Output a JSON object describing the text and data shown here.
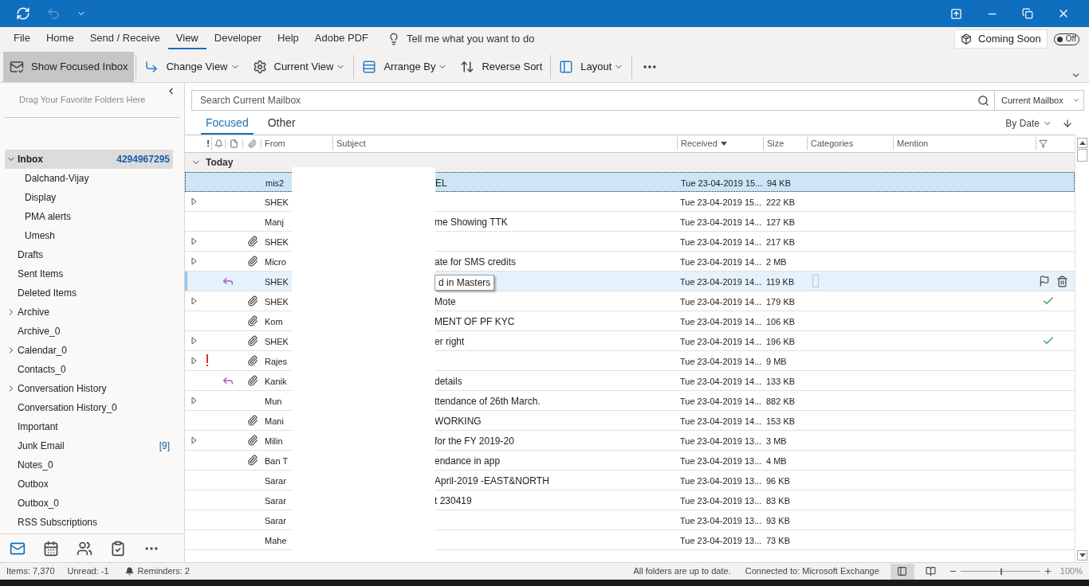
{
  "menu_tabs": [
    {
      "label": "File",
      "selected": false
    },
    {
      "label": "Home",
      "selected": false
    },
    {
      "label": "Send / Receive",
      "selected": false
    },
    {
      "label": "View",
      "selected": true
    },
    {
      "label": "Developer",
      "selected": false
    },
    {
      "label": "Help",
      "selected": false
    },
    {
      "label": "Adobe PDF",
      "selected": false
    }
  ],
  "tell_me": {
    "placeholder": "Tell me what you want to do"
  },
  "coming_soon": {
    "label": "Coming Soon",
    "toggle_label": "Off",
    "on": false
  },
  "ribbon": [
    {
      "kind": "focused",
      "label": "Show Focused Inbox",
      "selected": true
    },
    {
      "kind": "change",
      "label": "Change View",
      "selected": false
    },
    {
      "kind": "current",
      "label": "Current View",
      "selected": false
    },
    {
      "kind": "arrange",
      "label": "Arrange By",
      "selected": false
    },
    {
      "kind": "reverse",
      "label": "Reverse Sort",
      "selected": false
    },
    {
      "kind": "layout",
      "label": "Layout",
      "selected": false
    }
  ],
  "favorites_hint": "Drag Your Favorite Folders Here",
  "folders": [
    {
      "name": "Inbox",
      "count": "4294967295",
      "selected": true,
      "expanded": true,
      "children": [
        {
          "name": "Dalchand-Vijay",
          "selected": false
        },
        {
          "name": "Display",
          "selected": false
        },
        {
          "name": "PMA alerts",
          "selected": false
        },
        {
          "name": "Umesh",
          "selected": false
        }
      ]
    },
    {
      "name": "Drafts",
      "selected": false
    },
    {
      "name": "Sent Items",
      "selected": false
    },
    {
      "name": "Deleted Items",
      "selected": false
    },
    {
      "name": "Archive",
      "selected": false,
      "expanded": false
    },
    {
      "name": "Archive_0",
      "selected": false
    },
    {
      "name": "Calendar_0",
      "selected": false,
      "expanded": false
    },
    {
      "name": "Contacts_0",
      "selected": false
    },
    {
      "name": "Conversation History",
      "selected": false,
      "expanded": false
    },
    {
      "name": "Conversation History_0",
      "selected": false
    },
    {
      "name": "Important",
      "selected": false
    },
    {
      "name": "Junk Email",
      "count": "[9]",
      "selected": false
    },
    {
      "name": "Notes_0",
      "selected": false
    },
    {
      "name": "Outbox",
      "selected": false
    },
    {
      "name": "Outbox_0",
      "selected": false
    },
    {
      "name": "RSS Subscriptions",
      "selected": false
    }
  ],
  "nav": [
    {
      "kind": "mail",
      "selected": true
    },
    {
      "kind": "calendar",
      "selected": false
    },
    {
      "kind": "people",
      "selected": false
    },
    {
      "kind": "tasks",
      "selected": false
    },
    {
      "kind": "more",
      "selected": false
    }
  ],
  "search": {
    "placeholder": "Search Current Mailbox",
    "scope": "Current Mailbox"
  },
  "list_tabs": [
    {
      "label": "Focused",
      "selected": true
    },
    {
      "label": "Other",
      "selected": false
    }
  ],
  "sort": {
    "label": "By Date"
  },
  "columns": {
    "importance": "!",
    "from": "From",
    "subject": "Subject",
    "received": "Received",
    "size": "Size",
    "categories": "Categories",
    "mention": "Mention"
  },
  "group": {
    "label": "Today",
    "expanded": true
  },
  "rows": [
    {
      "from": "mis2",
      "subject": "EL",
      "received": "Tue 23-04-2019 15...",
      "size": "94 KB",
      "selected": true,
      "hovered": false,
      "expandable": false,
      "important": false,
      "replied": false,
      "attachment": false,
      "completed": false
    },
    {
      "from": "SHEK",
      "received": "Tue 23-04-2019 15...",
      "size": "222 KB",
      "selected": false,
      "hovered": false,
      "expandable": true,
      "important": false,
      "replied": false,
      "attachment": false,
      "completed": false
    },
    {
      "from": "Manj",
      "subject": "me Showing TTK",
      "received": "Tue 23-04-2019 14...",
      "size": "127 KB",
      "selected": false,
      "hovered": false,
      "expandable": false,
      "important": false,
      "replied": false,
      "attachment": false,
      "completed": false
    },
    {
      "from": "SHEK",
      "received": "Tue 23-04-2019 14...",
      "size": "217 KB",
      "selected": false,
      "hovered": false,
      "expandable": true,
      "important": false,
      "replied": false,
      "attachment": true,
      "completed": false
    },
    {
      "from": "Micro",
      "subject": "ate for SMS credits",
      "received": "Tue 23-04-2019 14...",
      "size": "2 MB",
      "selected": false,
      "hovered": false,
      "expandable": true,
      "important": false,
      "replied": false,
      "attachment": true,
      "completed": false
    },
    {
      "from": "SHEK",
      "tooltip": "d in Masters",
      "received": "Tue 23-04-2019 14...",
      "size": "119 KB",
      "selected": false,
      "hovered": true,
      "expandable": false,
      "important": false,
      "replied": true,
      "attachment": false,
      "completed": false
    },
    {
      "from": "SHEK",
      "subject": "Mote",
      "received": "Tue 23-04-2019 14...",
      "size": "179 KB",
      "selected": false,
      "hovered": false,
      "expandable": true,
      "important": false,
      "replied": false,
      "attachment": true,
      "completed": true
    },
    {
      "from": "Kom",
      "subject": "MENT OF PF KYC",
      "received": "Tue 23-04-2019 14...",
      "size": "106 KB",
      "selected": false,
      "hovered": false,
      "expandable": false,
      "important": false,
      "replied": false,
      "attachment": true,
      "completed": false
    },
    {
      "from": "SHEK",
      "subject": "er right",
      "received": "Tue 23-04-2019 14...",
      "size": "196 KB",
      "selected": false,
      "hovered": false,
      "expandable": true,
      "important": false,
      "replied": false,
      "attachment": true,
      "completed": true
    },
    {
      "from": "Rajes",
      "received": "Tue 23-04-2019 14...",
      "size": "9 MB",
      "selected": false,
      "hovered": false,
      "expandable": true,
      "important": true,
      "replied": false,
      "attachment": true,
      "completed": false
    },
    {
      "from": "Kanik",
      "subject": "details",
      "received": "Tue 23-04-2019 14...",
      "size": "133 KB",
      "selected": false,
      "hovered": false,
      "expandable": false,
      "important": false,
      "replied": true,
      "attachment": true,
      "completed": false
    },
    {
      "from": "Mun",
      "subject": "ttendance of 26th March.",
      "received": "Tue 23-04-2019 14...",
      "size": "882 KB",
      "selected": false,
      "hovered": false,
      "expandable": true,
      "important": false,
      "replied": false,
      "attachment": false,
      "completed": false
    },
    {
      "from": "Mani",
      "subject": "WORKING",
      "received": "Tue 23-04-2019 14...",
      "size": "153 KB",
      "selected": false,
      "hovered": false,
      "expandable": false,
      "important": false,
      "replied": false,
      "attachment": true,
      "completed": false
    },
    {
      "from": "Milin",
      "subject": "for the FY 2019-20",
      "received": "Tue 23-04-2019 13...",
      "size": "3 MB",
      "selected": false,
      "hovered": false,
      "expandable": true,
      "important": false,
      "replied": false,
      "attachment": true,
      "completed": false
    },
    {
      "from": "Ban T",
      "subject": "endance in app",
      "received": "Tue 23-04-2019 13...",
      "size": "4 MB",
      "selected": false,
      "hovered": false,
      "expandable": false,
      "important": false,
      "replied": false,
      "attachment": true,
      "completed": false
    },
    {
      "from": "Sarar",
      "subject": "April-2019 -EAST&NORTH",
      "received": "Tue 23-04-2019 13...",
      "size": "96 KB",
      "selected": false,
      "hovered": false,
      "expandable": false,
      "important": false,
      "replied": false,
      "attachment": false,
      "completed": false
    },
    {
      "from": "Sarar",
      "subject": "t 230419",
      "received": "Tue 23-04-2019 13...",
      "size": "83 KB",
      "selected": false,
      "hovered": false,
      "expandable": false,
      "important": false,
      "replied": false,
      "attachment": false,
      "completed": false
    },
    {
      "from": "Sarar",
      "received": "Tue 23-04-2019 13...",
      "size": "93 KB",
      "selected": false,
      "hovered": false,
      "expandable": false,
      "important": false,
      "replied": false,
      "attachment": false,
      "completed": false
    },
    {
      "from": "Mahe",
      "received": "Tue 23-04-2019 13...",
      "size": "73 KB",
      "selected": false,
      "hovered": false,
      "expandable": false,
      "important": false,
      "replied": false,
      "attachment": false,
      "completed": false
    }
  ],
  "status_bar": {
    "items": "Items: 7,370",
    "unread": "Unread: -1",
    "reminders": "Reminders: 2",
    "sync": "All folders are up to date.",
    "connection": "Connected to: Microsoft Exchange",
    "zoom": {
      "level": 0.5,
      "reading": "100%"
    }
  }
}
